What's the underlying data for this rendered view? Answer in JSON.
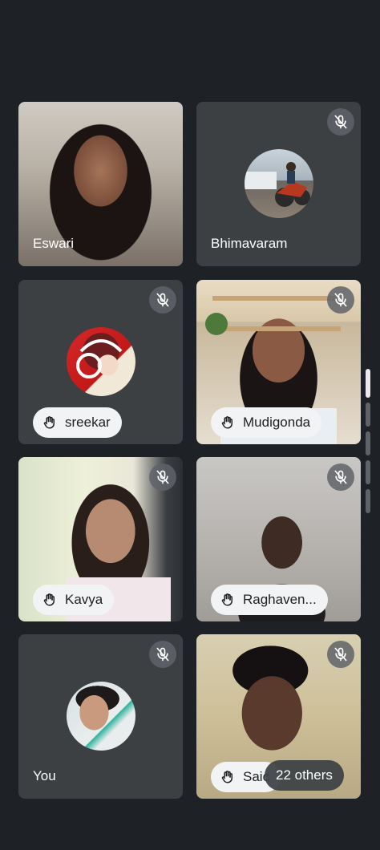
{
  "participants": [
    {
      "name": "Eswari",
      "muted": false,
      "hand_raised": false,
      "camera_on": true
    },
    {
      "name": "Bhimavaram",
      "muted": true,
      "hand_raised": false,
      "camera_on": false
    },
    {
      "name": "sreekar",
      "muted": true,
      "hand_raised": true,
      "camera_on": false
    },
    {
      "name": "Mudigonda",
      "muted": true,
      "hand_raised": true,
      "camera_on": true
    },
    {
      "name": "Kavya",
      "muted": true,
      "hand_raised": true,
      "camera_on": true
    },
    {
      "name": "Raghaven...",
      "muted": true,
      "hand_raised": true,
      "camera_on": true
    },
    {
      "name": "You",
      "muted": true,
      "hand_raised": false,
      "camera_on": false
    },
    {
      "name": "Saic",
      "muted": true,
      "hand_raised": true,
      "camera_on": true
    }
  ],
  "others_label": "22 others",
  "colors": {
    "background": "#1e2125",
    "tile": "#3c4043",
    "active_border": "#1a6fa8",
    "chip": "#f1f3f4"
  },
  "icons": {
    "mute": "mic-off-icon",
    "hand": "raised-hand-icon"
  }
}
